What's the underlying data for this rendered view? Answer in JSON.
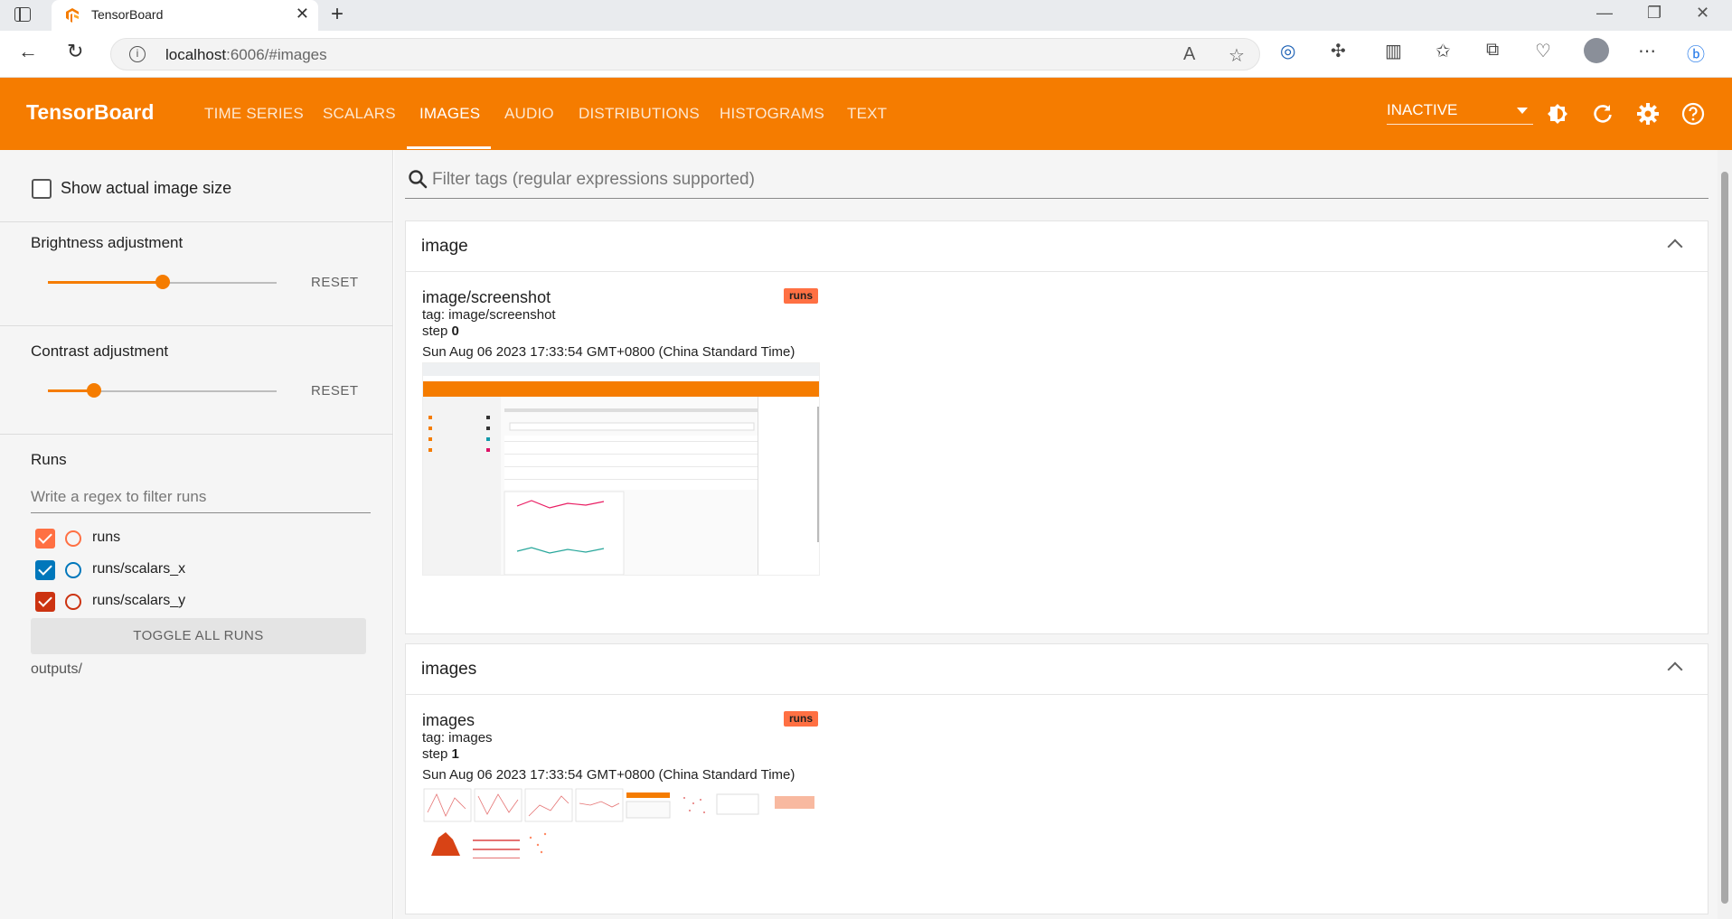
{
  "browser": {
    "tab_title": "TensorBoard",
    "url_host": "localhost",
    "url_rest": ":6006/#images"
  },
  "header": {
    "brand": "TensorBoard",
    "tabs": [
      {
        "label": "TIME SERIES"
      },
      {
        "label": "SCALARS"
      },
      {
        "label": "IMAGES"
      },
      {
        "label": "AUDIO"
      },
      {
        "label": "DISTRIBUTIONS"
      },
      {
        "label": "HISTOGRAMS"
      },
      {
        "label": "TEXT"
      }
    ],
    "active_tab": "IMAGES",
    "status": "INACTIVE",
    "accent": "#f57c00"
  },
  "sidebar": {
    "show_actual_size": "Show actual image size",
    "brightness": {
      "label": "Brightness adjustment",
      "reset": "RESET",
      "value": 0.5
    },
    "contrast": {
      "label": "Contrast adjustment",
      "reset": "RESET",
      "value": 0.2
    },
    "runs_title": "Runs",
    "runs_filter_placeholder": "Write a regex to filter runs",
    "runs": [
      {
        "name": "runs",
        "color": "#ff7043",
        "checked": true
      },
      {
        "name": "runs/scalars_x",
        "color": "#0077bb",
        "checked": true
      },
      {
        "name": "runs/scalars_y",
        "color": "#cc3311",
        "checked": true
      }
    ],
    "toggle_all": "TOGGLE ALL RUNS",
    "logdir": "outputs/"
  },
  "main": {
    "filter_placeholder": "Filter tags (regular expressions supported)",
    "cards": [
      {
        "title": "image",
        "image": {
          "name": "image/screenshot",
          "tag": "tag: image/screenshot",
          "step_label": "step ",
          "step": "0",
          "timestamp": "Sun Aug 06 2023 17:33:54 GMT+0800 (China Standard Time)",
          "run": "runs"
        }
      },
      {
        "title": "images",
        "image": {
          "name": "images",
          "tag": "tag: images",
          "step_label": "step ",
          "step": "1",
          "timestamp": "Sun Aug 06 2023 17:33:54 GMT+0800 (China Standard Time)",
          "run": "runs"
        }
      }
    ]
  }
}
